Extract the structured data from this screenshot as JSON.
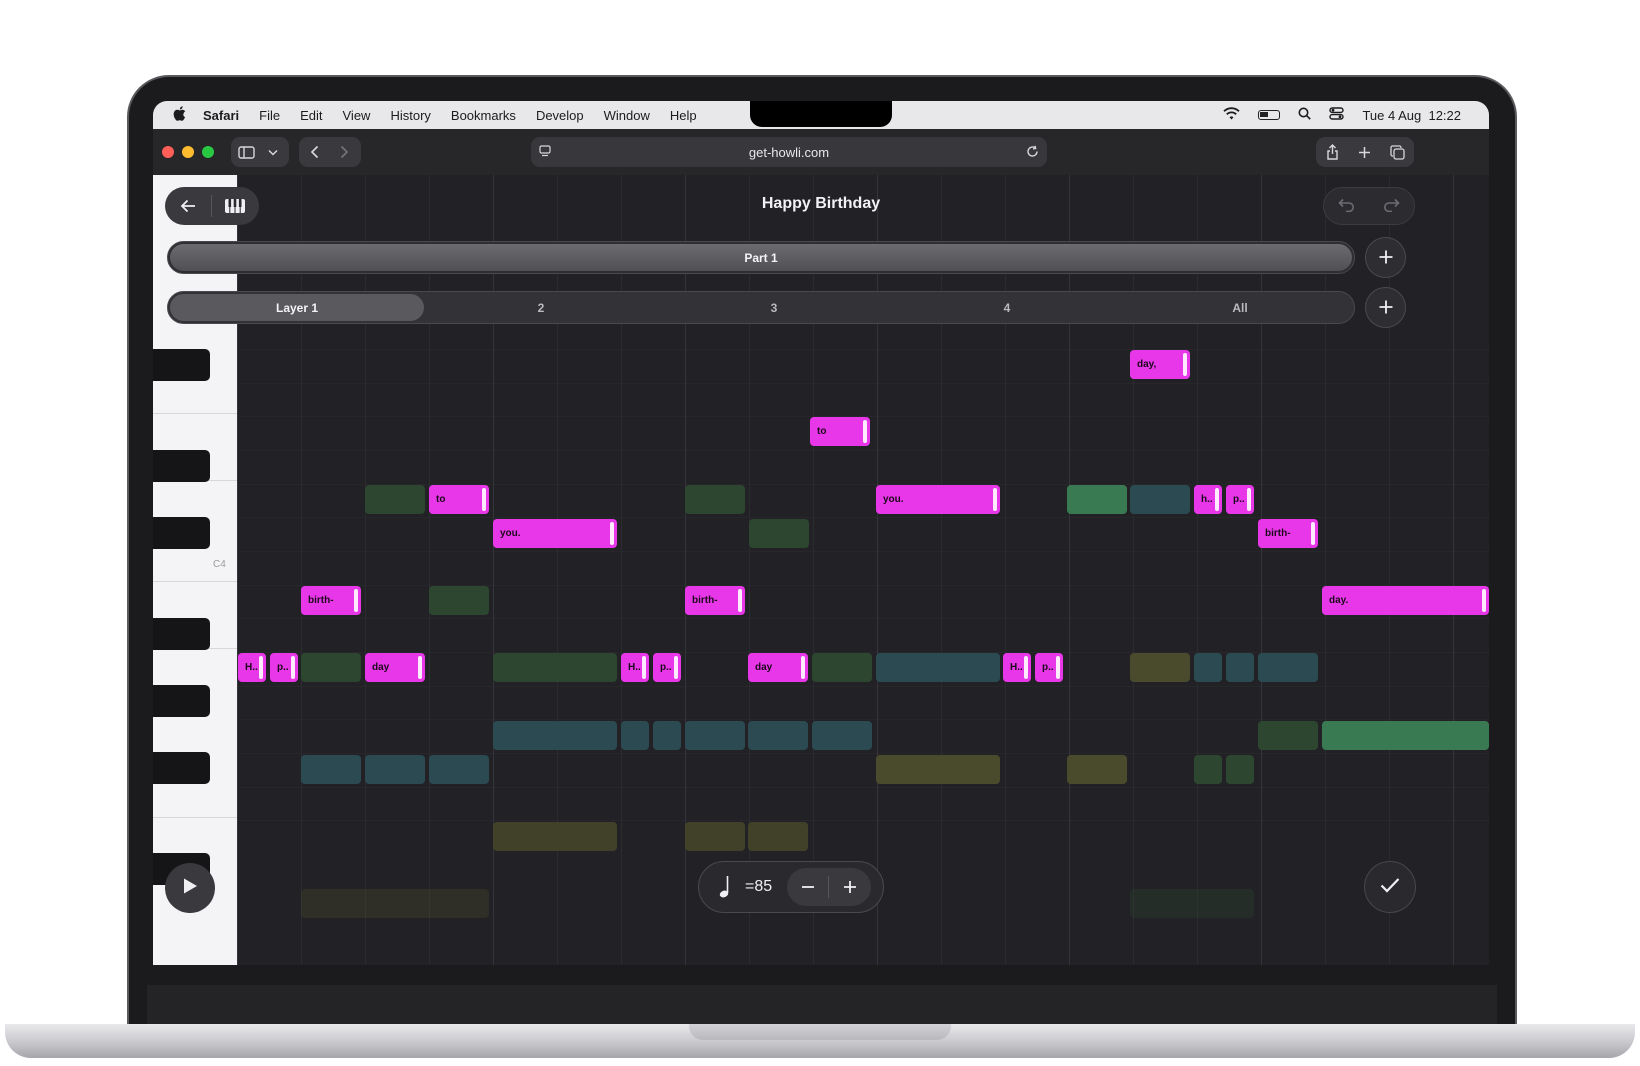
{
  "menubar": {
    "app_name": "Safari",
    "menus": [
      "File",
      "Edit",
      "View",
      "History",
      "Bookmarks",
      "Develop",
      "Window",
      "Help"
    ],
    "datetime": "Tue 4 Aug  12:22"
  },
  "browser": {
    "url": "get-howli.com"
  },
  "app": {
    "title": "Happy Birthday",
    "part_label": "Part 1",
    "layers": [
      "Layer 1",
      "2",
      "3",
      "4",
      "All"
    ],
    "piano_label": "C4",
    "tempo_value": "=85",
    "notes_lyrics": [
      "day,",
      "to",
      "to",
      "you.",
      "you.",
      "h..",
      "p..",
      "birth-",
      "birth-",
      "birth-",
      "day.",
      "H..",
      "p..",
      "day",
      "H..",
      "p..",
      "day",
      "H..",
      "p.."
    ]
  },
  "colors": {
    "lyric_note": "#e837e8",
    "ghost_green": "#2d4630",
    "ghost_teal": "#2c4a52",
    "ghost_olive": "#4a4a2c",
    "ghost_bright_green": "#3a7a52"
  },
  "icons": [
    "apple-icon",
    "wifi-icon",
    "battery-icon",
    "search-icon",
    "control-center-icon",
    "sidebar-icon",
    "chevron-down-icon",
    "back-icon",
    "forward-icon",
    "site-settings-icon",
    "reload-icon",
    "share-icon",
    "new-tab-icon",
    "tabs-overview-icon",
    "arrow-left-icon",
    "piano-icon",
    "undo-icon",
    "redo-icon",
    "plus-icon",
    "play-icon",
    "quarter-note-icon",
    "minus-icon",
    "checkmark-icon"
  ]
}
